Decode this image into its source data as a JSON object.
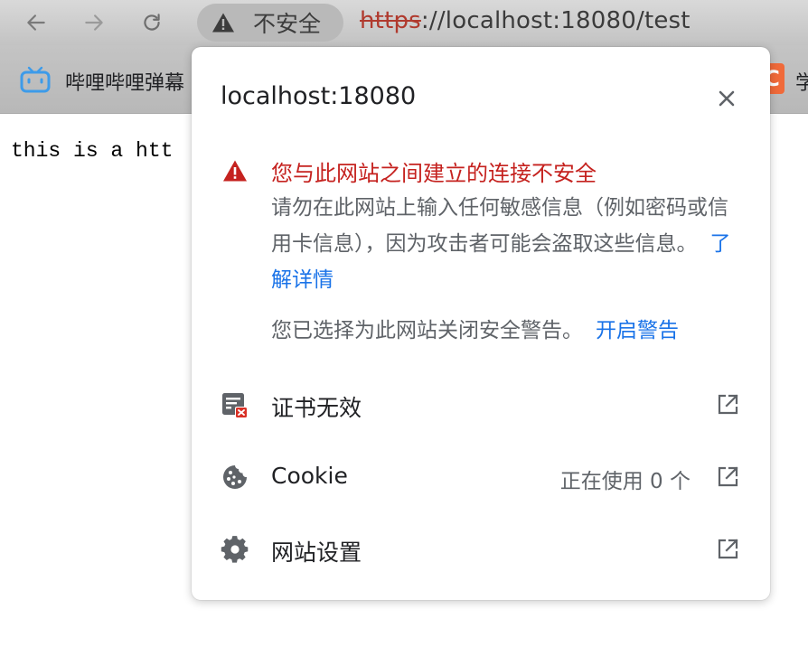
{
  "toolbar": {
    "back_icon": "arrow-left-icon",
    "forward_icon": "arrow-right-icon",
    "reload_icon": "reload-icon",
    "security_chip": {
      "icon": "warning-triangle-icon",
      "label": "不安全"
    },
    "url": {
      "scheme": "https",
      "rest": "://localhost:18080/test"
    }
  },
  "bookmarks": {
    "items": [
      {
        "icon": "bilibili-tv-icon",
        "label": "哔哩哔哩弹幕"
      },
      {
        "icon": "csdn-c-icon",
        "label": "C"
      },
      {
        "label": "学"
      }
    ]
  },
  "page": {
    "text": "this is a htt"
  },
  "popup": {
    "title": "localhost:18080",
    "close_icon": "close-icon",
    "alert": {
      "icon": "warning-triangle-icon",
      "title": "您与此网站之间建立的连接不安全",
      "body": "请勿在此网站上输入任何敏感信息（例如密码或信用卡信息），因为攻击者可能会盗取这些信息。",
      "learn_more": "了解详情"
    },
    "warnings_off": {
      "text": "您已选择为此网站关闭安全警告。",
      "enable_link": "开启警告"
    },
    "rows": [
      {
        "icon": "certificate-invalid-icon",
        "label": "证书无效",
        "value": "",
        "ext_icon": "open-in-new-icon"
      },
      {
        "icon": "cookie-icon",
        "label": "Cookie",
        "value": "正在使用 0 个",
        "ext_icon": "open-in-new-icon"
      },
      {
        "icon": "gear-icon",
        "label": "网站设置",
        "value": "",
        "ext_icon": "open-in-new-icon"
      }
    ]
  },
  "colors": {
    "danger": "#c5221f",
    "link": "#1a73e8",
    "secondary_text": "#5f6368"
  }
}
